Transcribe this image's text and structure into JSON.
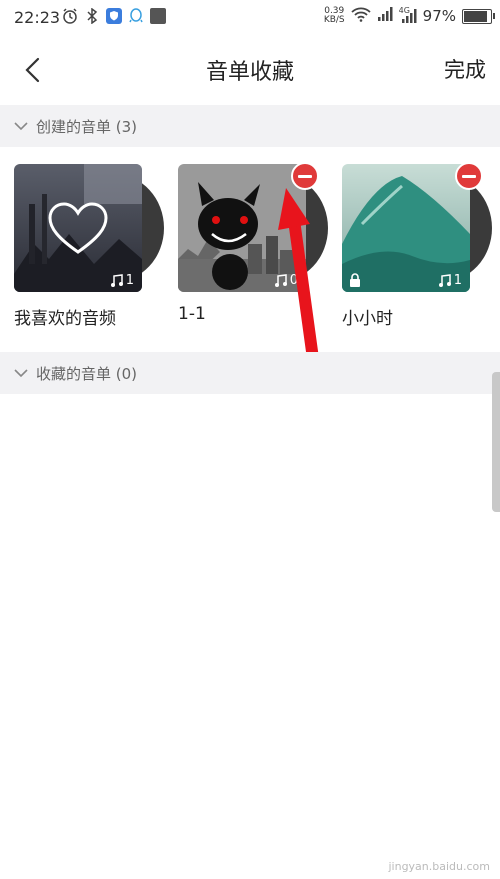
{
  "status_bar": {
    "time": "22:23",
    "speed_value": "0.39",
    "speed_unit": "KB/S",
    "network_label": "4G",
    "battery": "97%",
    "battery_level": 0.97,
    "icons": [
      "alarm-icon",
      "bluetooth-icon",
      "shield-app-icon",
      "qq-icon",
      "square-app-icon",
      "wifi-icon",
      "signal-icon",
      "signal-4g-icon",
      "battery-icon"
    ]
  },
  "header": {
    "title": "音单收藏",
    "done_label": "完成",
    "back_icon": "back-arrow-icon"
  },
  "sections": [
    {
      "label": "创建的音单 (3)"
    },
    {
      "label": "收藏的音单 (0)"
    }
  ],
  "playlists": [
    {
      "title": "我喜欢的音频",
      "count": "1",
      "removable": false,
      "locked": false
    },
    {
      "title": "1-1",
      "count": "0",
      "removable": true,
      "locked": false
    },
    {
      "title": "小小时",
      "count": "1",
      "removable": true,
      "locked": true
    }
  ],
  "watermark": "jingyan.baidu.com",
  "colors": {
    "remove": "#e03a3a",
    "annotation_arrow": "#e8141c",
    "section_bg": "#f2f2f4"
  }
}
